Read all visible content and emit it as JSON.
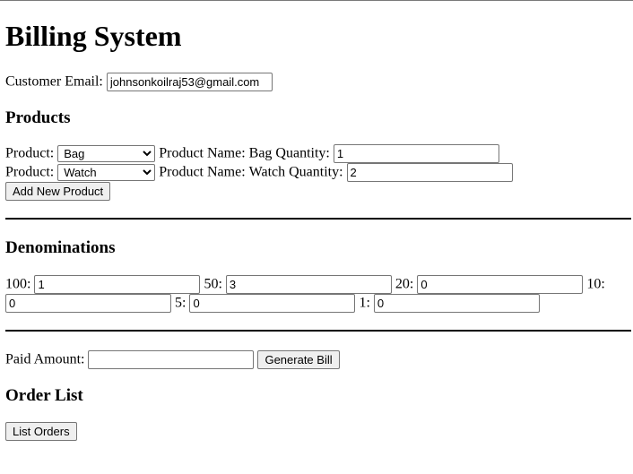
{
  "title": "Billing System",
  "customer": {
    "label": "Customer Email:",
    "value": "johnsonkoilraj53@gmail.com"
  },
  "products": {
    "heading": "Products",
    "items": [
      {
        "product_label": "Product:",
        "selected": "Bag",
        "name_label": "Product Name:",
        "name": "Bag",
        "quantity_label": "Quantity:",
        "quantity": "1"
      },
      {
        "product_label": "Product:",
        "selected": "Watch",
        "name_label": "Product Name:",
        "name": "Watch",
        "quantity_label": "Quantity:",
        "quantity": "2"
      }
    ],
    "add_button": "Add New Product"
  },
  "denominations": {
    "heading": "Denominations",
    "items": [
      {
        "label": "100:",
        "value": "1"
      },
      {
        "label": "50:",
        "value": "3"
      },
      {
        "label": "20:",
        "value": "0"
      },
      {
        "label": "10:",
        "value": "0"
      },
      {
        "label": "5:",
        "value": "0"
      },
      {
        "label": "1:",
        "value": "0"
      }
    ]
  },
  "payment": {
    "label": "Paid Amount:",
    "value": "",
    "generate_button": "Generate Bill"
  },
  "orders": {
    "heading": "Order List",
    "list_button": "List Orders"
  }
}
